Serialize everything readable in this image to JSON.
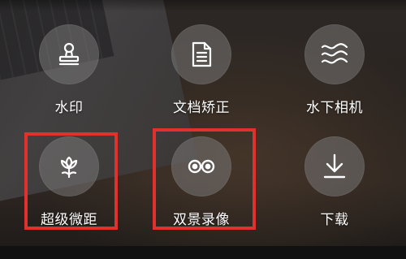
{
  "tiles": [
    {
      "label": "水印",
      "icon": "stamp-icon"
    },
    {
      "label": "文档矫正",
      "icon": "document-icon"
    },
    {
      "label": "水下相机",
      "icon": "waves-icon"
    },
    {
      "label": "超级微距",
      "icon": "flower-icon"
    },
    {
      "label": "双景录像",
      "icon": "dual-view-icon"
    },
    {
      "label": "下载",
      "icon": "download-icon"
    }
  ],
  "colors": {
    "highlight": "#e0312f",
    "label": "#ffffff"
  }
}
